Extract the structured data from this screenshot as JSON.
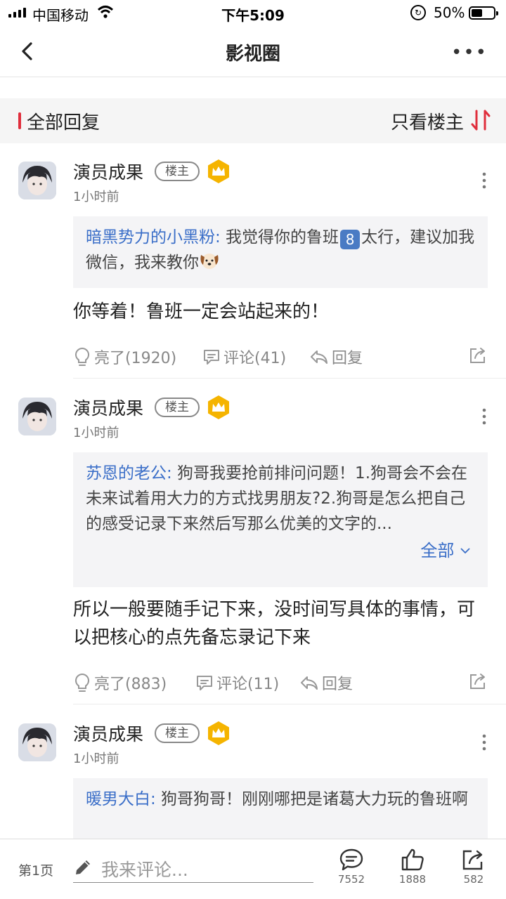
{
  "status_bar": {
    "carrier": "中国移动",
    "time": "下午5:09",
    "battery_percent": "50%",
    "battery_level": 0.5
  },
  "nav": {
    "title": "影视圈"
  },
  "filter": {
    "all_replies": "全部回复",
    "owner_only": "只看楼主"
  },
  "posts": [
    {
      "author": "演员成果",
      "badge": "楼主",
      "time": "1小时前",
      "quote_user": "暗黑势力的小黑粉:",
      "quote_text_a": " 我觉得你的鲁班",
      "quote_emoji_num": "8",
      "quote_text_b": "太行，建议加我微信，我来教你",
      "reply": "你等着！鲁班一定会站起来的！",
      "likes": "亮了(1920)",
      "comments": "评论(41)",
      "reply_label": "回复"
    },
    {
      "author": "演员成果",
      "badge": "楼主",
      "time": "1小时前",
      "quote_user": "苏恩的老公:",
      "quote_text": " 狗哥我要抢前排问问题！1.狗哥会不会在未来试着用大力的方式找男朋友?2.狗哥是怎么把自己的感受记录下来然后写那么优美的文字的...",
      "expand_label": "全部",
      "reply": "所以一般要随手记下来，没时间写具体的事情，可以把核心的点先备忘录记下来",
      "likes": "亮了(883)",
      "comments": "评论(11)",
      "reply_label": "回复"
    },
    {
      "author": "演员成果",
      "badge": "楼主",
      "time": "1小时前",
      "quote_user": "暖男大白:",
      "quote_text": " 狗哥狗哥！刚刚哪把是诸葛大力玩的鲁班啊"
    }
  ],
  "bottom_bar": {
    "page": "第1页",
    "placeholder": "我来评论...",
    "comment_count": "7552",
    "like_count": "1888",
    "share_count": "582"
  },
  "colors": {
    "accent_red": "#e02e3c",
    "link_blue": "#3a6ec8",
    "crown_gold": "#f5b400"
  }
}
